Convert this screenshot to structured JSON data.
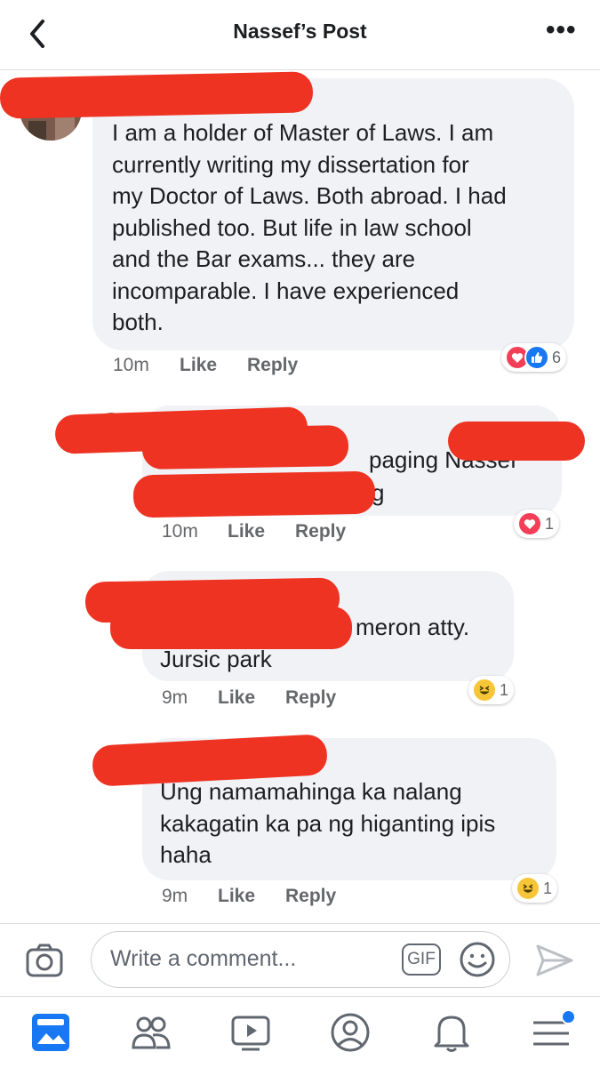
{
  "header": {
    "title": "Nassef’s Post",
    "back_icon": "chevron-left-icon",
    "more_icon": "more-dots-icon",
    "more_glyph": "•••"
  },
  "comments": [
    {
      "text_lines": [
        "I am a holder of Master of Laws. I am",
        "currently writing my dissertation for",
        "my Doctor of Laws. Both abroad. I had",
        "published too. But life in law school",
        "and the Bar exams... they are",
        "incomparable. I have experienced",
        "both."
      ],
      "time": "10m",
      "like": "Like",
      "reply": "Reply",
      "reaction_count": "6",
      "reactions": [
        "heart-icon",
        "like-icon"
      ]
    },
    {
      "text_lines": [
        "paging Nassef",
        "g"
      ],
      "time": "10m",
      "like": "Like",
      "reply": "Reply",
      "reaction_count": "1",
      "reactions": [
        "heart-icon"
      ]
    },
    {
      "text_lines": [
        "meron atty.",
        "Jursic park"
      ],
      "time": "9m",
      "like": "Like",
      "reply": "Reply",
      "reaction_count": "1",
      "reactions": [
        "haha-icon"
      ]
    },
    {
      "text_lines": [
        "Ung namamahinga ka nalang",
        "kakagatin ka pa ng higanting ipis",
        "haha"
      ],
      "time": "9m",
      "like": "Like",
      "reply": "Reply",
      "reaction_count": "1",
      "reactions": [
        "haha-icon"
      ]
    }
  ],
  "composer": {
    "placeholder": "Write a comment...",
    "gif_label": "GIF",
    "camera_icon": "camera-icon",
    "emoji_icon": "emoji-icon",
    "send_icon": "send-icon"
  },
  "nav": {
    "items": [
      "news-feed-icon",
      "groups-icon",
      "watch-icon",
      "profile-icon",
      "notifications-icon",
      "menu-icon"
    ],
    "active": "news-feed-icon"
  },
  "colors": {
    "accent": "#1877f2",
    "bubble": "#f0f2f5",
    "redaction": "#ee3323",
    "heart": "#f33e58",
    "haha": "#f7c638"
  }
}
